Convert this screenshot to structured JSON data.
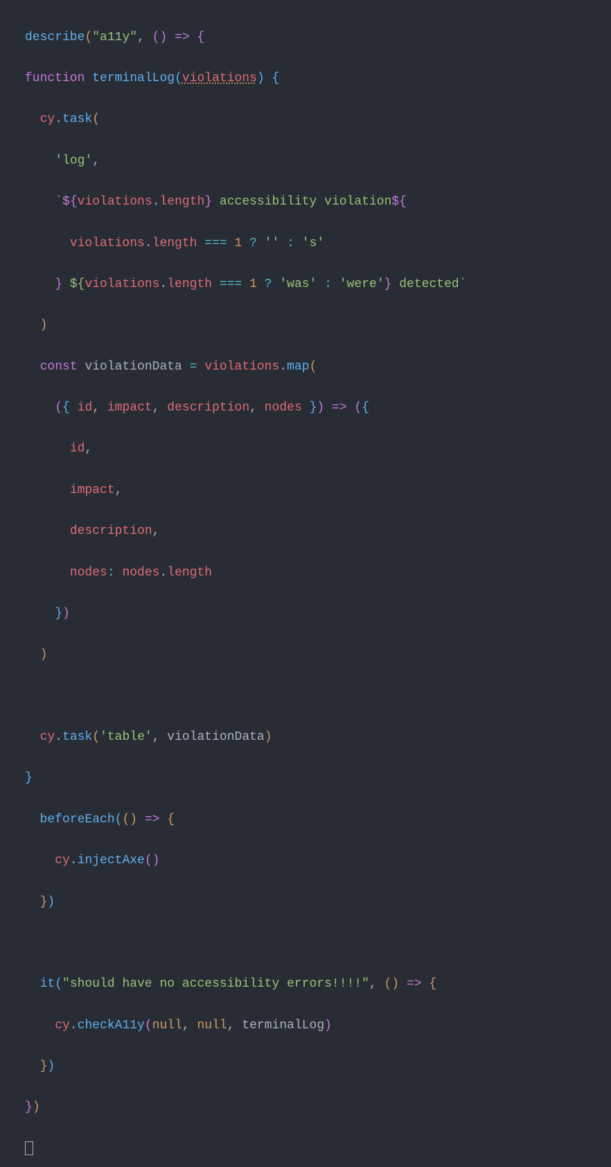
{
  "code": {
    "describe": "describe",
    "a11y": "\"a11y\"",
    "arrow": "=>",
    "function": "function",
    "terminalLog": "terminalLog",
    "violations": "violations",
    "cy": "cy",
    "task": "task",
    "log": "'log'",
    "tmpl_open": "`${",
    "violations_length": "violations",
    "length": "length",
    "a11y_violation": " accessibility violation",
    "dollar_brace": "${",
    "triple_eq": "===",
    "one": "1",
    "qmark": "?",
    "empty": "''",
    "colon": ":",
    "s": "'s'",
    "close_brace": "}",
    "space_dollar": " ${",
    "was": "'was'",
    "were": "'were'",
    "detected": " detected`",
    "const": "const",
    "violationData": "violationData",
    "eq": "=",
    "map": "map",
    "id": "id",
    "impact": "impact",
    "description": "description",
    "nodes": "nodes",
    "table": "'table'",
    "beforeEach": "beforeEach",
    "injectAxe": "injectAxe",
    "it": "it",
    "it_string": "\"should have no accessibility errors!!!!\"",
    "checkA11y": "checkA11y",
    "null": "null"
  }
}
